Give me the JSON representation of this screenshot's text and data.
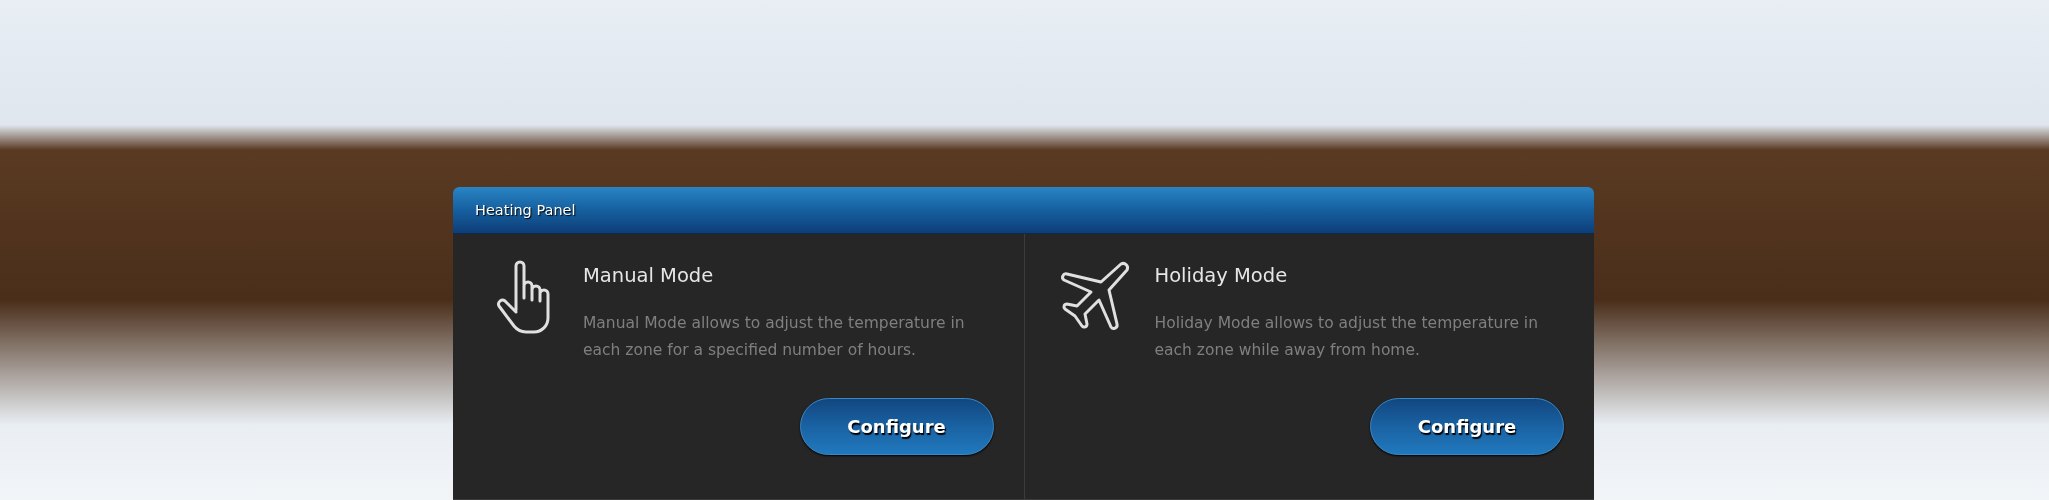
{
  "panel": {
    "title": "Heating Panel"
  },
  "modes": [
    {
      "kind": "manual",
      "title": "Manual Mode",
      "description": "Manual Mode allows to adjust the temperature in each zone for a specified number of hours.",
      "button": "Configure"
    },
    {
      "kind": "holiday",
      "title": "Holiday Mode",
      "description": "Holiday Mode allows to adjust the temperature in each zone while away from home.",
      "button": "Configure"
    }
  ]
}
